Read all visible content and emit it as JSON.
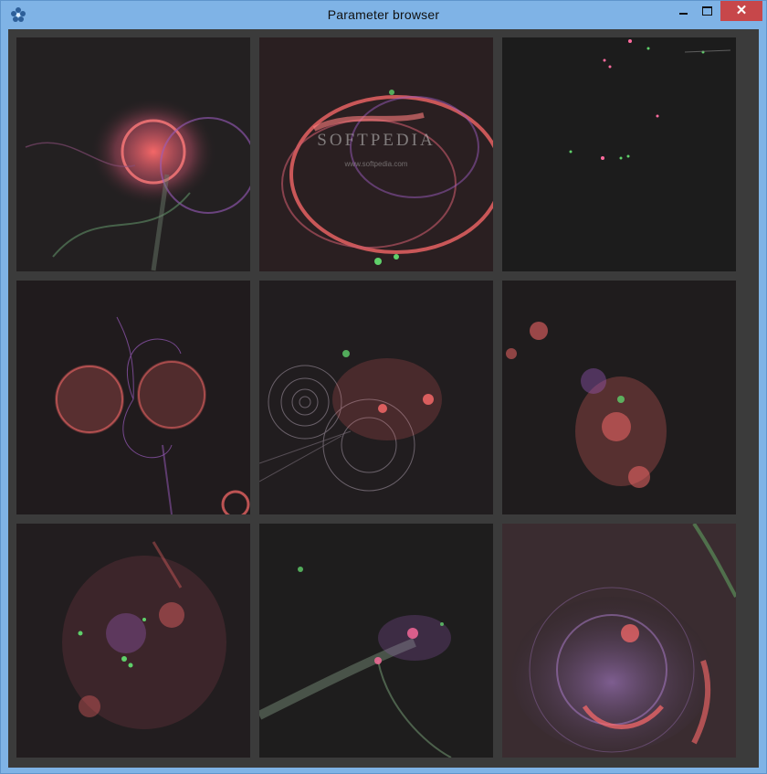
{
  "window": {
    "title": "Parameter browser",
    "app_icon": "flower-icon",
    "controls": {
      "minimize_icon": "minimize-icon",
      "maximize_icon": "maximize-icon",
      "close_icon": "close-icon",
      "close_glyph": "✕"
    }
  },
  "watermark": {
    "text": "SOFTPEDIA",
    "url": "www.softpedia.com"
  },
  "colors": {
    "titlebar": "#7fb3e6",
    "client_bg": "#3b3b3b",
    "tile_bg": "#1c1c1c",
    "close_button": "#c7474a",
    "fractal_pink": "#ff6b6b",
    "fractal_purple": "#9a5bbd",
    "fractal_green": "#5fd06a"
  },
  "grid": {
    "rows": 3,
    "columns": 3,
    "tiles": [
      {
        "id": 1,
        "style": "dense-swirl"
      },
      {
        "id": 2,
        "style": "ring-loops"
      },
      {
        "id": 3,
        "style": "sparse-dots"
      },
      {
        "id": 4,
        "style": "butterfly-field"
      },
      {
        "id": 5,
        "style": "orbit-circles"
      },
      {
        "id": 6,
        "style": "scattered-cloud"
      },
      {
        "id": 7,
        "style": "speckled-field"
      },
      {
        "id": 8,
        "style": "green-streak"
      },
      {
        "id": 9,
        "style": "glowing-rings"
      }
    ]
  }
}
